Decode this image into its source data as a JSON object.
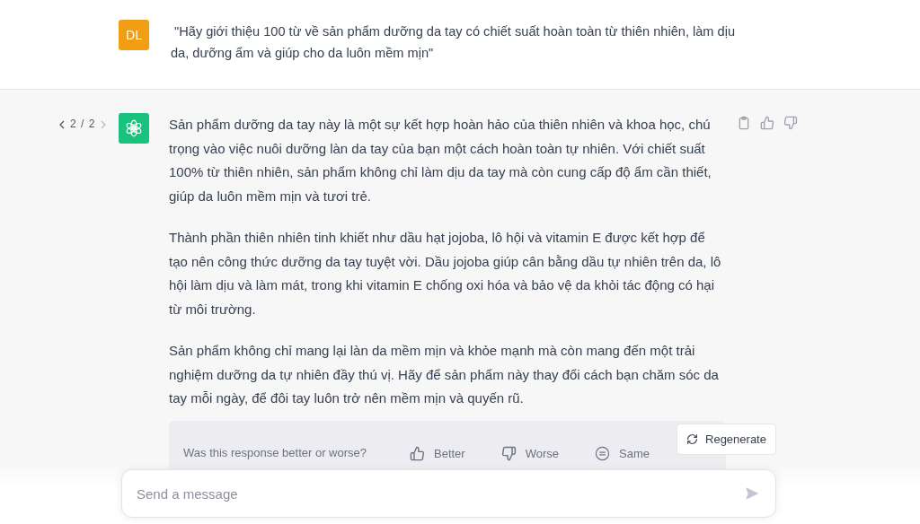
{
  "user_message": {
    "avatar": "DL",
    "text": " \"Hãy giới thiệu 100 từ về sản phẩm dưỡng da tay có chiết suất hoàn toàn từ thiên nhiên, làm dịu da, dưỡng ẩm và giúp cho da luôn mềm mịn\""
  },
  "assistant_message": {
    "pager": "2 / 2",
    "paragraphs": [
      "Sản phẩm dưỡng da tay này là một sự kết hợp hoàn hảo của thiên nhiên và khoa học, chú trọng vào việc nuôi dưỡng làn da tay của bạn một cách hoàn toàn tự nhiên. Với chiết suất 100% từ thiên nhiên, sản phẩm không chỉ làm dịu da tay mà còn cung cấp độ ẩm cần thiết, giúp da luôn mềm mịn và tươi trẻ.",
      "Thành phần thiên nhiên tinh khiết như dầu hạt jojoba, lô hội và vitamin E được kết hợp để tạo nên công thức dưỡng da tay tuyệt vời. Dầu jojoba giúp cân bằng dầu tự nhiên trên da, lô hội làm dịu và làm mát, trong khi vitamin E chống oxi hóa và bảo vệ da khỏi tác động có hại từ môi trường.",
      "Sản phẩm không chỉ mang lại làn da mềm mịn và khỏe mạnh mà còn mang đến một trải nghiệm dưỡng da tự nhiên đầy thú vị. Hãy để sản phẩm này thay đổi cách bạn chăm sóc da tay mỗi ngày, để đôi tay luôn trở nên mềm mịn và quyến rũ."
    ]
  },
  "feedback": {
    "question": "Was this response better or worse?",
    "options": [
      {
        "kind": "better",
        "label": "Better"
      },
      {
        "kind": "worse",
        "label": "Worse"
      },
      {
        "kind": "same",
        "label": "Same"
      }
    ]
  },
  "regenerate_button": "Regenerate",
  "composer": {
    "placeholder": "Send a message"
  }
}
